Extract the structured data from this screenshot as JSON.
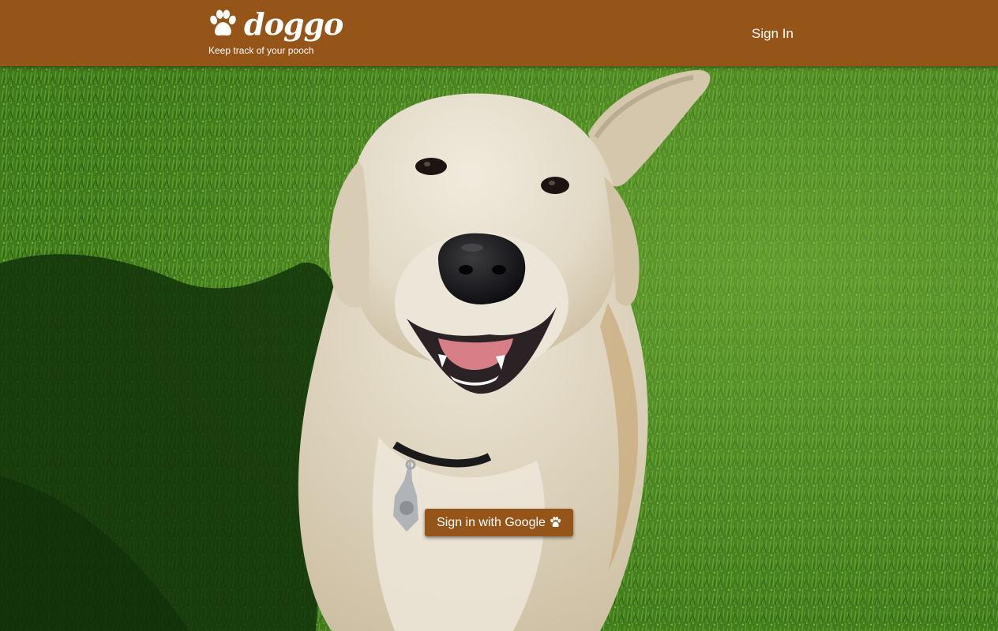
{
  "header": {
    "brand_name": "doggo",
    "tagline": "Keep track of your pooch",
    "sign_in_label": "Sign In"
  },
  "hero": {
    "google_button_label": "Sign in with Google"
  },
  "icons": {
    "logo": "paw-icon",
    "button": "paw-icon"
  },
  "colors": {
    "brand": "#955518",
    "text_on_brand": "#ffffff",
    "grass": "#3f7a1c"
  }
}
